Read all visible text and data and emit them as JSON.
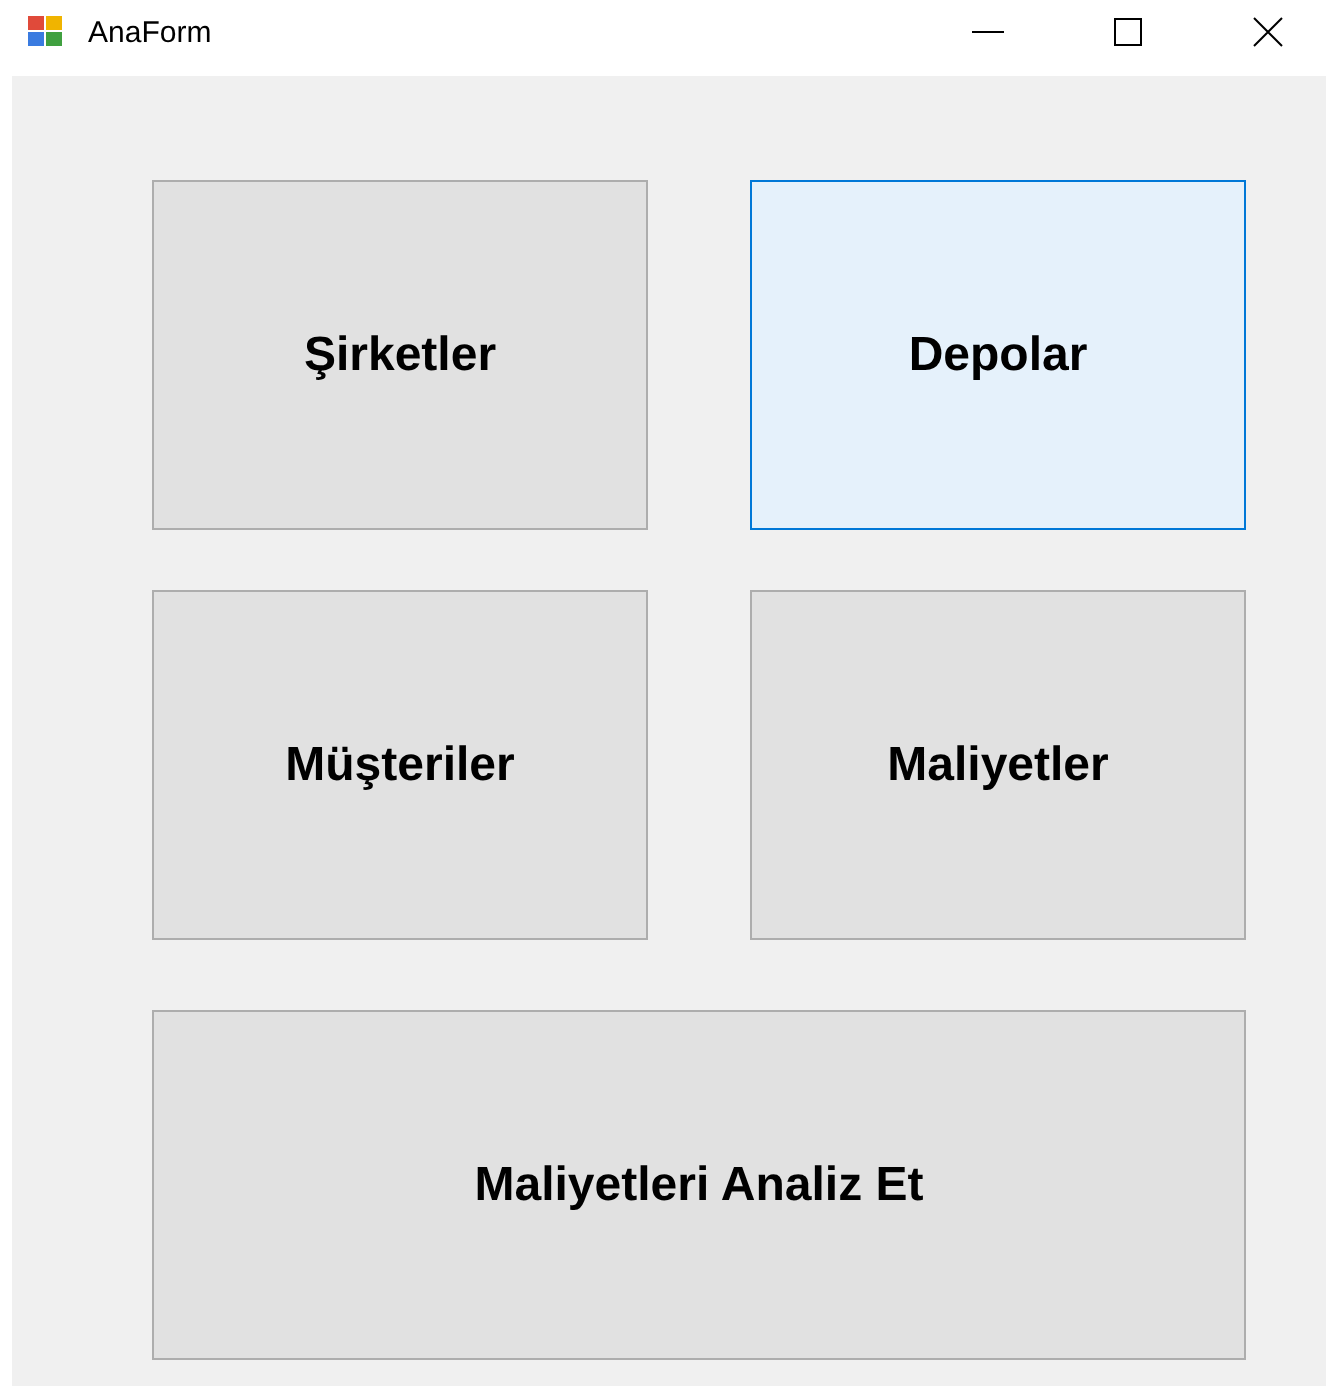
{
  "window": {
    "title": "AnaForm"
  },
  "buttons": [
    {
      "label": "Şirketler",
      "hovered": false
    },
    {
      "label": "Depolar",
      "hovered": true
    },
    {
      "label": "Müşteriler",
      "hovered": false
    },
    {
      "label": "Maliyetler",
      "hovered": false
    },
    {
      "label": "Maliyetleri Analiz Et",
      "hovered": false
    }
  ]
}
